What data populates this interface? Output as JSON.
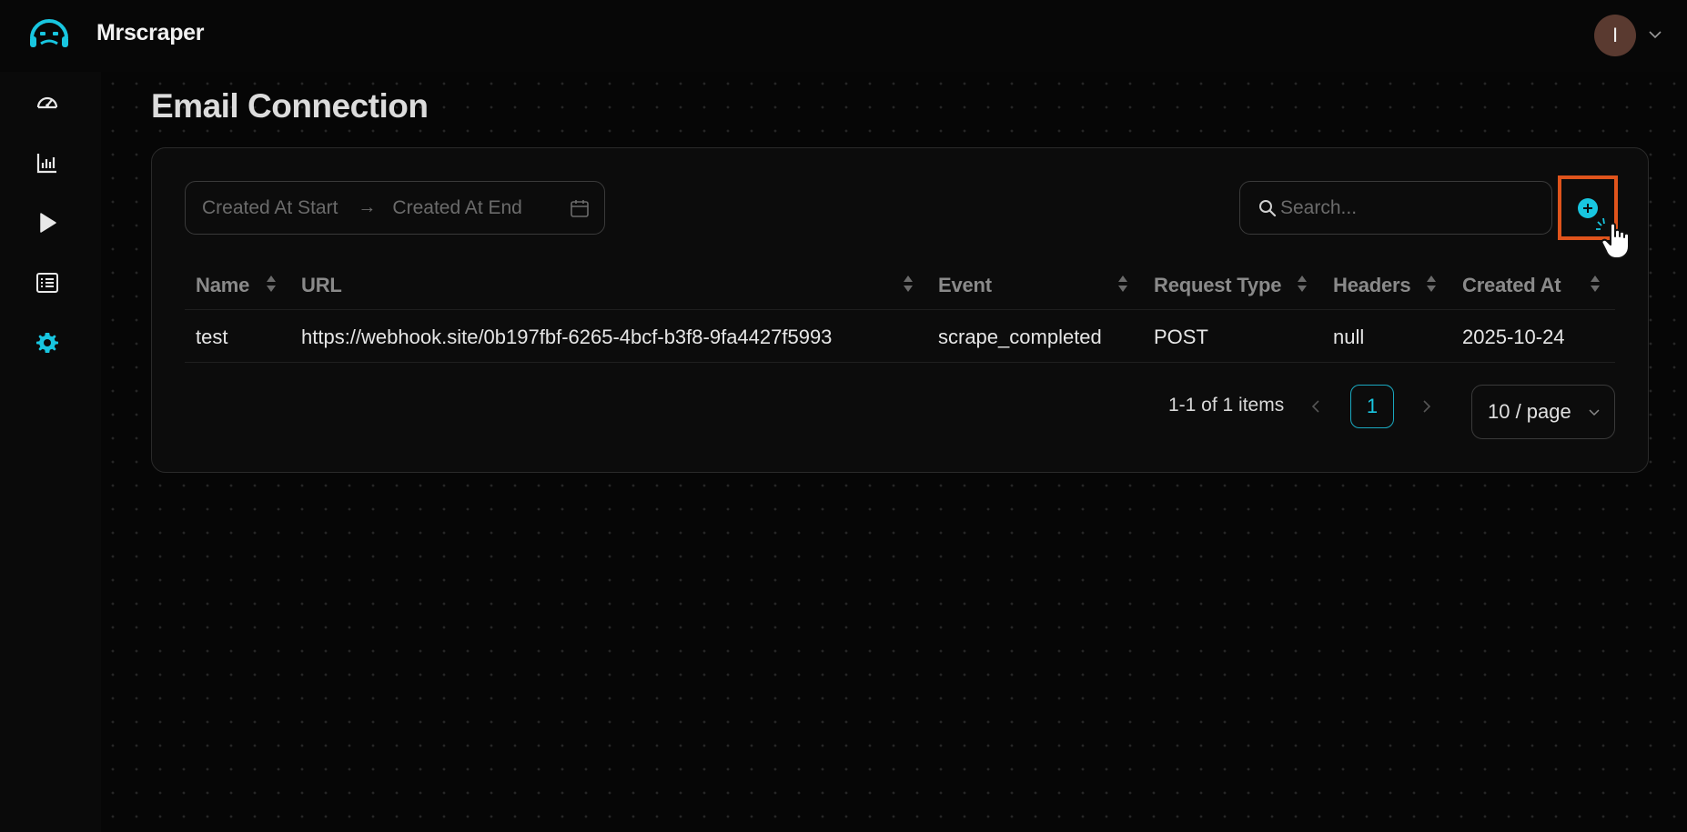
{
  "app": {
    "name": "Mrscraper"
  },
  "user": {
    "avatar_initial": "I"
  },
  "sidebar": {
    "items": [
      {
        "icon": "dashboard-gauge-icon",
        "active": false
      },
      {
        "icon": "bar-chart-icon",
        "active": false
      },
      {
        "icon": "play-icon",
        "active": false
      },
      {
        "icon": "list-icon",
        "active": false
      },
      {
        "icon": "gear-icon",
        "active": true
      }
    ]
  },
  "page": {
    "title": "Email Connection"
  },
  "filters": {
    "start_placeholder": "Created At Start",
    "end_placeholder": "Created At End",
    "search_placeholder": "Search..."
  },
  "table": {
    "columns": [
      "Name",
      "URL",
      "Event",
      "Request Type",
      "Headers",
      "Created At"
    ],
    "rows": [
      [
        "test",
        "https://webhook.site/0b197fbf-6265-4bcf-b3f8-9fa4427f5993",
        "scrape_completed",
        "POST",
        "null",
        "2025-10-24"
      ]
    ]
  },
  "pagination": {
    "total_text": "1-1 of 1 items",
    "current_page": "1",
    "page_size": "10 / page"
  },
  "colors": {
    "accent": "#18c6e0",
    "highlight": "#e0541c",
    "background": "#000000"
  }
}
